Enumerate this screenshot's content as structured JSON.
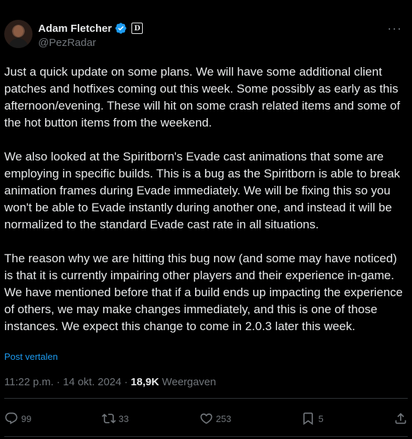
{
  "author": {
    "display_name": "Adam Fletcher",
    "handle": "@PezRadar",
    "affiliate_badge": "D",
    "verified_color": "#1d9bf0"
  },
  "post": {
    "paragraphs": [
      "Just a quick update on some plans. We will have some additional client patches and hotfixes coming out this week. Some possibly as early as this afternoon/evening. These will hit on some crash related items and some of the hot button items from the weekend.",
      "We also looked at the Spiritborn's Evade cast animations that some are employing in specific builds. This is a bug as the Spiritborn is able to break animation frames during Evade immediately. We will be fixing this so you won't be able to Evade instantly during another one, and instead it will be normalized to the standard Evade cast rate in all situations.",
      "The reason why we are hitting this bug now (and some may have noticed) is that it is currently impairing other players and their experience in-game. We have mentioned before that if a build ends up impacting the experience of others, we may make changes immediately, and this is one of those instances. We expect this change to come in 2.0.3 later this week."
    ],
    "translate_label": "Post vertalen"
  },
  "meta": {
    "time": "11:22 p.m.",
    "separator": "·",
    "date": "14 okt. 2024",
    "views_count": "18,9K",
    "views_label": "Weergaven"
  },
  "actions": {
    "replies": "99",
    "reposts": "33",
    "likes": "253",
    "bookmarks": "5"
  },
  "icons": [
    "more-icon",
    "verified-icon",
    "reply-icon",
    "repost-icon",
    "like-icon",
    "bookmark-icon",
    "share-icon"
  ]
}
